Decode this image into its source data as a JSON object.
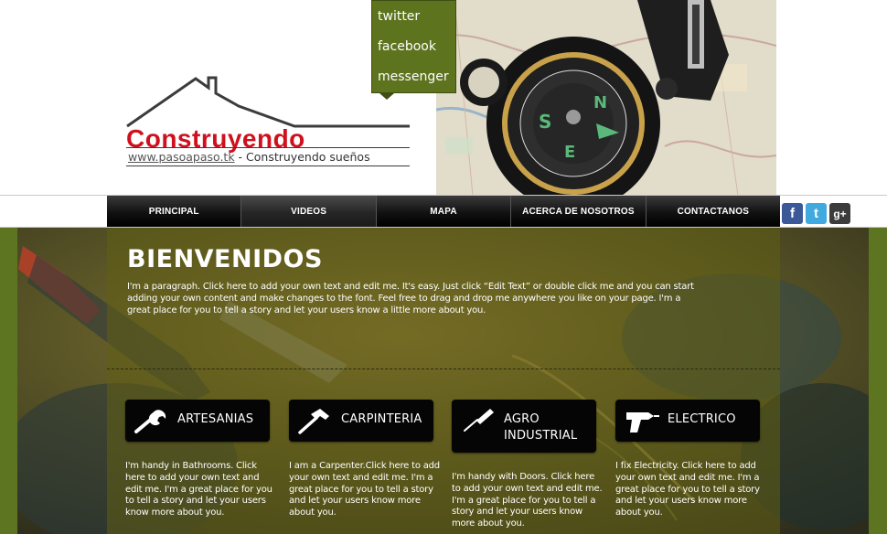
{
  "brand": {
    "name": "Construyendo",
    "url_text": "www.pasoapaso.tk",
    "tagline_sep": " - ",
    "tagline": "Construyendo sueños",
    "name_color": "#d0101c"
  },
  "social_menu": {
    "items": [
      "twitter",
      "facebook",
      "messenger"
    ],
    "bg_color": "#5e731e"
  },
  "nav": {
    "items": [
      {
        "label": "PRINCIPAL",
        "active": false
      },
      {
        "label": "VIDEOS",
        "active": true
      },
      {
        "label": "MAPA",
        "active": false
      },
      {
        "label": "ACERCA DE NOSOTROS",
        "active": false
      },
      {
        "label": "CONTACTANOS",
        "active": false
      }
    ]
  },
  "social_icons": [
    {
      "name": "facebook-icon",
      "glyph": "f",
      "color": "#3b5998"
    },
    {
      "name": "twitter-icon",
      "glyph": "t",
      "color": "#3fa9e0"
    },
    {
      "name": "google-plus-icon",
      "glyph": "g+",
      "color": "#3c3c3c"
    }
  ],
  "welcome": {
    "title": "BIENVENIDOS",
    "text": "I'm a paragraph. Click here to add your own text and edit me. It's easy. Just click “Edit Text” or double click me and you can start adding your own content and make changes to the font. Feel free to drag and drop me anywhere you like on your page. I'm a great place for you to tell a story and let your users know a little more about you."
  },
  "services": [
    {
      "label": "ARTESANIAS",
      "icon": "wrench-icon",
      "desc": "I'm handy in Bathrooms. Click here to add your own text and edit me. I'm a great place for you to tell a story and let your users know more about you."
    },
    {
      "label": "CARPINTERIA",
      "icon": "hammer-icon",
      "desc": "I am a Carpenter.Click here to add your own text and edit me. I'm a great place for you to tell a story and let your users know more about you."
    },
    {
      "label": "AGRO INDUSTRIAL",
      "icon": "screwdriver-icon",
      "desc": "I'm handy with Doors. Click here to add your own text and edit me. I'm a great place for you to tell a story and let your users know more about you."
    },
    {
      "label": "ELECTRICO",
      "icon": "drill-icon",
      "desc": "I fix Electricity. Click here to add your own text and edit me. I'm a great place for you to tell a story and let your users know more about you."
    }
  ],
  "colors": {
    "accent_green": "#5d7520",
    "nav_black": "#000000"
  }
}
